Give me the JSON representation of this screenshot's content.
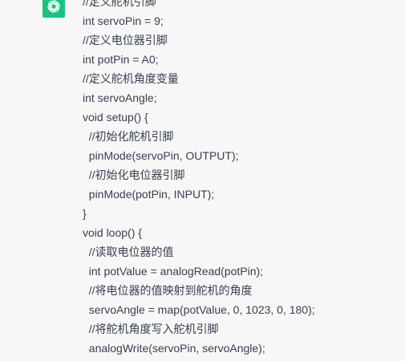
{
  "message": {
    "avatar_icon": "openai-logo-icon",
    "avatar_color": "#19c37d",
    "text_color": "#374151",
    "code_lines": [
      "//定义舵机引脚",
      "int servoPin = 9;",
      "//定义电位器引脚",
      "int potPin = A0;",
      "//定义舵机角度变量",
      "int servoAngle;",
      "void setup() {",
      "  //初始化舵机引脚",
      "  pinMode(servoPin, OUTPUT);",
      "  //初始化电位器引脚",
      "  pinMode(potPin, INPUT);",
      "}",
      "void loop() {",
      "  //读取电位器的值",
      "  int potValue = analogRead(potPin);",
      "  //将电位器的值映射到舵机的角度",
      "  servoAngle = map(potValue, 0, 1023, 0, 180);",
      "  //将舵机角度写入舵机引脚",
      "  analogWrite(servoPin, servoAngle);"
    ]
  }
}
